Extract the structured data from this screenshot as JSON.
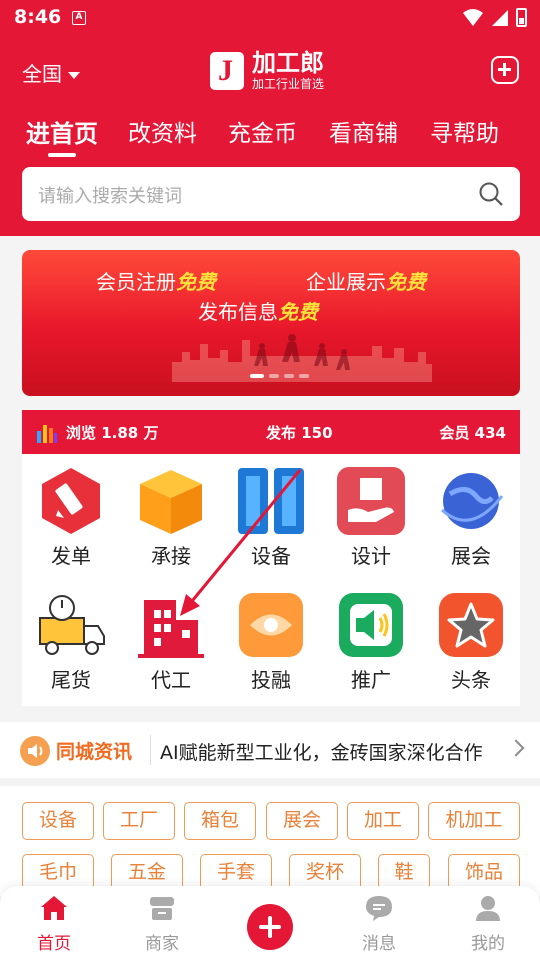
{
  "status": {
    "time": "8:46",
    "notif_letter": "A"
  },
  "header": {
    "region": "全国",
    "logo_title": "加工郎",
    "logo_subtitle": "加工行业首选"
  },
  "tabs": [
    "进首页",
    "改资料",
    "充金币",
    "看商铺",
    "寻帮助"
  ],
  "search": {
    "placeholder": "请输入搜索关键词"
  },
  "banner": {
    "line1_prefix": "会员注册",
    "line1_em": "免费",
    "line2_prefix": "企业展示",
    "line2_em": "免费",
    "line3_prefix": "发布信息",
    "line3_em": "免费"
  },
  "stats": {
    "views": "浏览 1.88 万",
    "posts": "发布 150",
    "members": "会员 434"
  },
  "categories": [
    {
      "label": "发单",
      "icon": "pencil-hexagon-icon"
    },
    {
      "label": "承接",
      "icon": "box-icon"
    },
    {
      "label": "设备",
      "icon": "binders-icon"
    },
    {
      "label": "设计",
      "icon": "hand-box-icon"
    },
    {
      "label": "展会",
      "icon": "globe-icon"
    },
    {
      "label": "尾货",
      "icon": "truck-timer-icon"
    },
    {
      "label": "代工",
      "icon": "factory-icon"
    },
    {
      "label": "投融",
      "icon": "eye-icon"
    },
    {
      "label": "推广",
      "icon": "speaker-icon"
    },
    {
      "label": "头条",
      "icon": "star-icon"
    }
  ],
  "news": {
    "title": "同城资讯",
    "text": "AI赋能新型工业化，金砖国家深化合作"
  },
  "tags": [
    "设备",
    "工厂",
    "箱包",
    "展会",
    "加工",
    "机加工",
    "毛巾",
    "五金",
    "手套",
    "奖杯",
    "鞋",
    "饰品"
  ],
  "bottom_nav": [
    {
      "label": "首页",
      "icon": "home-icon",
      "active": true
    },
    {
      "label": "商家",
      "icon": "store-icon",
      "active": false
    },
    {
      "label": "消息",
      "icon": "message-icon",
      "active": false
    },
    {
      "label": "我的",
      "icon": "user-icon",
      "active": false
    }
  ],
  "colors": {
    "brand": "#e41737",
    "tag_orange": "#e8823a",
    "news_orange": "#f06a20"
  }
}
